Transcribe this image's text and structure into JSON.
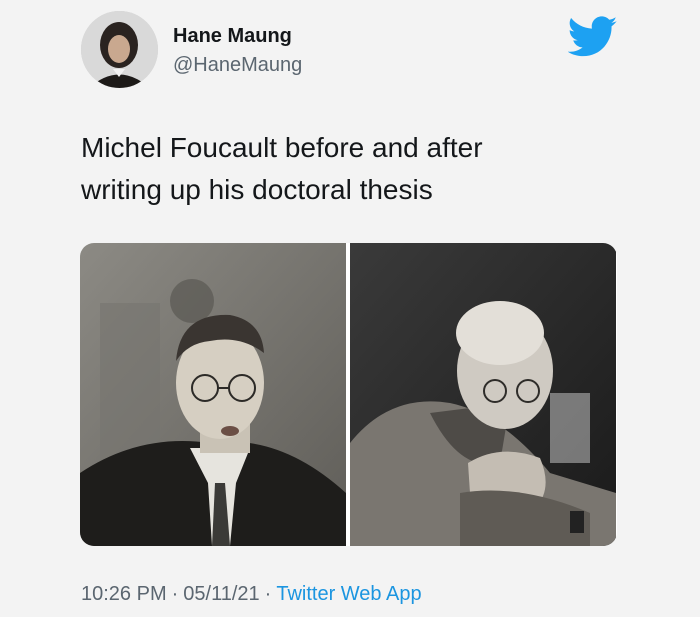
{
  "user": {
    "display_name": "Hane Maung",
    "handle": "@HaneMaung"
  },
  "tweet": {
    "text_lines": [
      "Michel Foucault before and after",
      "writing up his doctoral thesis"
    ]
  },
  "media": {
    "photos": [
      {
        "icon": "young-foucault-photo"
      },
      {
        "icon": "older-foucault-photo"
      }
    ]
  },
  "meta": {
    "time": "10:26 PM",
    "separator": "·",
    "date": "05/11/21",
    "source_app": "Twitter Web App"
  },
  "colors": {
    "twitter_blue": "#1da1f2",
    "link_blue": "#1b95e0",
    "secondary_text": "#5b6670"
  }
}
